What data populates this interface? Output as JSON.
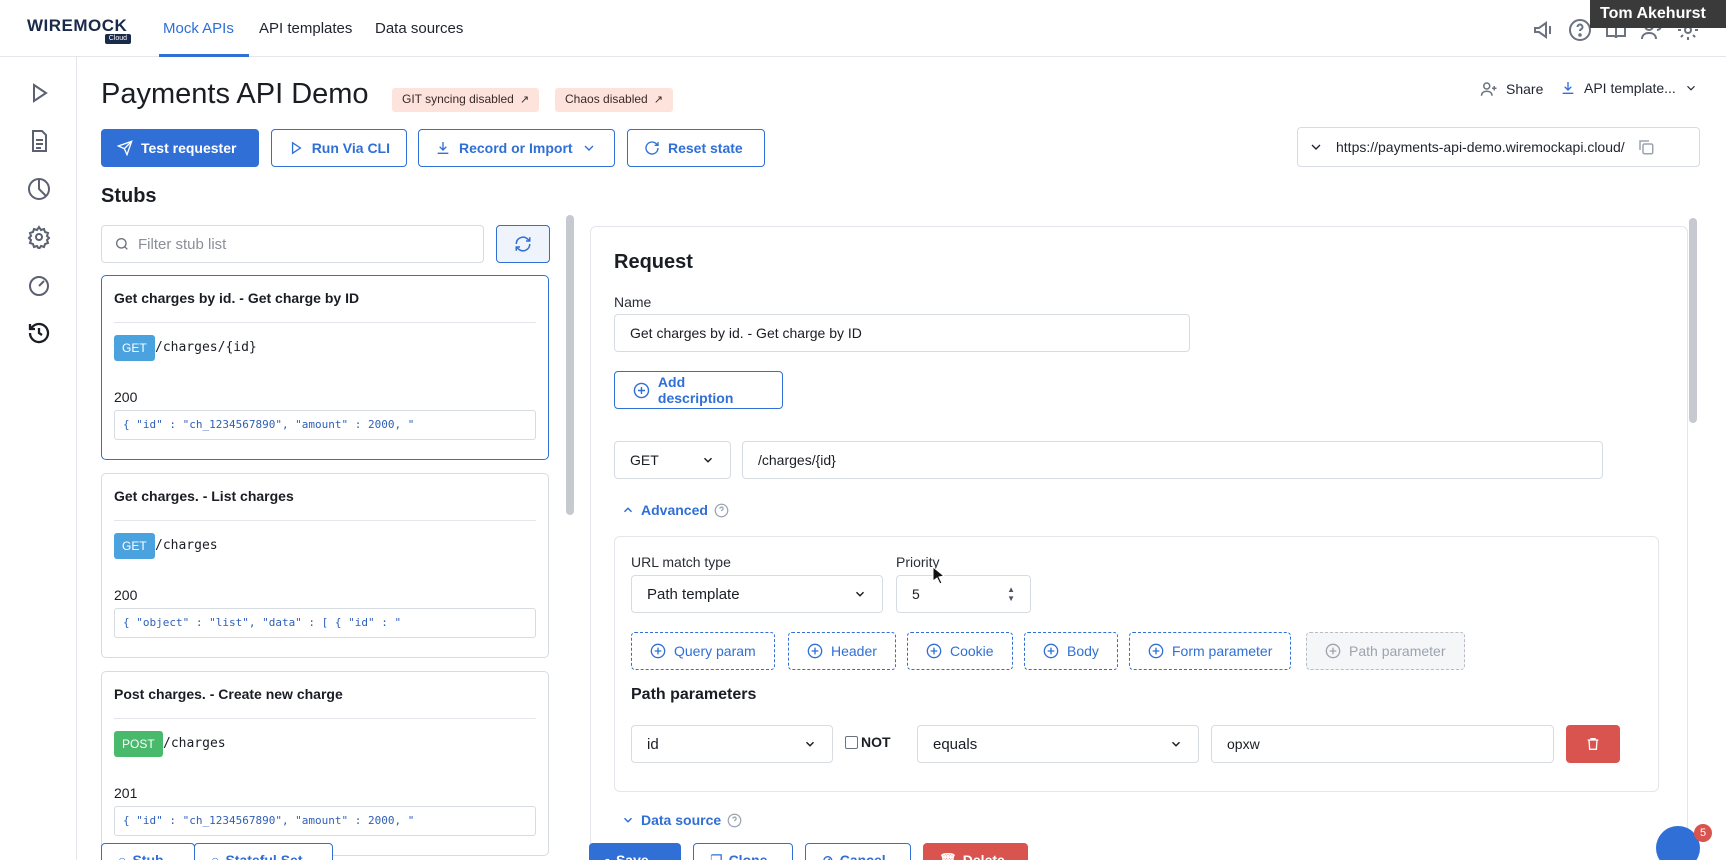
{
  "brand": {
    "logo_text": "WIREMOCK",
    "logo_sub": "Cloud"
  },
  "nav": {
    "tabs": [
      {
        "label": "Mock APIs",
        "active": true
      },
      {
        "label": "API templates"
      },
      {
        "label": "Data sources"
      }
    ]
  },
  "user": {
    "name": "Tom Akehurst"
  },
  "header": {
    "title": "Payments API Demo",
    "tags": [
      "GIT syncing disabled",
      "Chaos disabled"
    ],
    "buttons": {
      "test_requester": "Test requester",
      "run_cli": "Run Via CLI",
      "record_import": "Record or Import",
      "reset_state": "Reset state"
    },
    "share": "Share",
    "api_template": "API template...",
    "base_url": "https://payments-api-demo.wiremockapi.cloud/"
  },
  "stubs": {
    "title": "Stubs",
    "filter_placeholder": "Filter stub list",
    "items": [
      {
        "title": "Get charges by id. - Get charge by ID",
        "method": "GET",
        "path": "/charges/{id}",
        "status": "200",
        "body": "{ \"id\" : \"ch_1234567890\", \"amount\" : 2000, \""
      },
      {
        "title": "Get charges. - List charges",
        "method": "GET",
        "path": "/charges",
        "status": "200",
        "body": "{ \"object\" : \"list\", \"data\" : [ { \"id\" : \""
      },
      {
        "title": "Post charges. - Create new charge",
        "method": "POST",
        "path": "/charges",
        "status": "201",
        "body": "{ \"id\" : \"ch_1234567890\", \"amount\" : 2000, \""
      }
    ]
  },
  "request": {
    "title": "Request",
    "name_label": "Name",
    "name_value": "Get charges by id. - Get charge by ID",
    "add_description": "Add description",
    "method": "GET",
    "url": "/charges/{id}",
    "advanced_label": "Advanced",
    "url_match_type_label": "URL match type",
    "url_match_type_value": "Path template",
    "priority_label": "Priority",
    "priority_value": "5",
    "chips": [
      "Query param",
      "Header",
      "Cookie",
      "Body",
      "Form parameter",
      "Path parameter"
    ],
    "path_params_title": "Path parameters",
    "path_param": {
      "name": "id",
      "not_label": "NOT",
      "operator": "equals",
      "value": "opxw"
    },
    "data_source_label": "Data source"
  },
  "bottom": {
    "stub": "Stub",
    "stateful_set": "Stateful Set",
    "save": "Save",
    "clone": "Clone",
    "cancel": "Cancel",
    "delete": "Delete"
  },
  "chat": {
    "count": "5"
  },
  "colors": {
    "primary": "#2f6fd6",
    "get_badge": "#4aa3df",
    "post_badge": "#49b96b",
    "tag_bg": "#fde3dc",
    "danger": "#d9534f"
  }
}
